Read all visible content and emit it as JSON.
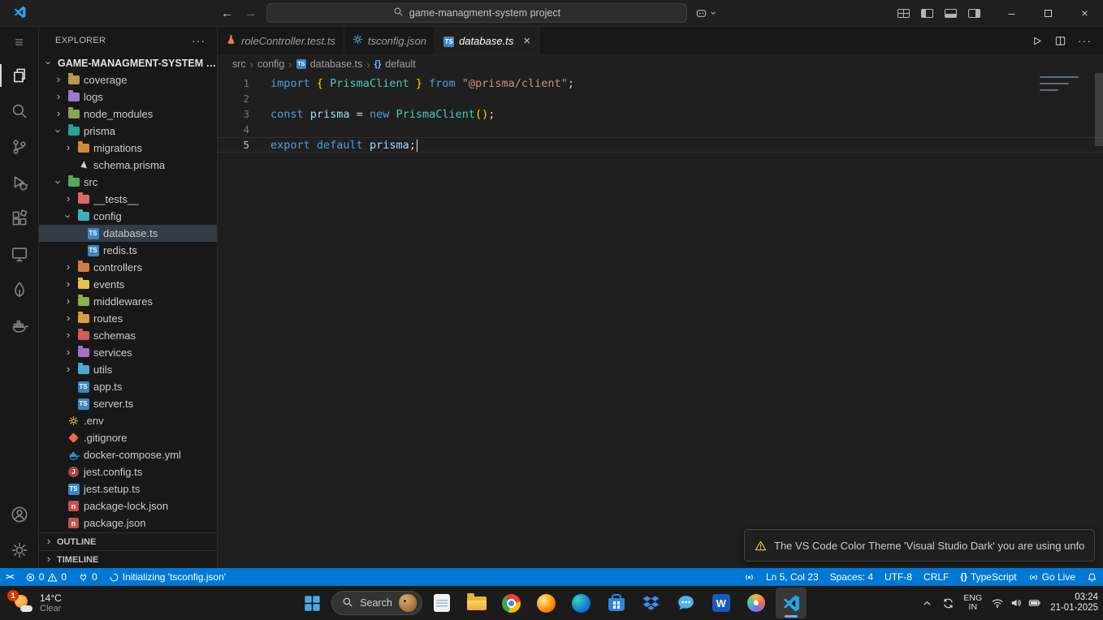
{
  "colors": {
    "titlebar": "#1f1f1f",
    "side": "#181818",
    "editor": "#1f1f1f",
    "statusbar": "#0078d4",
    "taskbar": "#1b1b1b",
    "selection": "#323d47",
    "ts_badge": "#3b86c4",
    "accent": "#6cb2f0"
  },
  "titlebar": {
    "search_text": "game-managment-system project",
    "layout_icons": [
      "layout-customize",
      "layout-sidebar-left",
      "layout-panel",
      "layout-sidebar-right"
    ],
    "window_controls": [
      "minimize",
      "maximize",
      "close"
    ]
  },
  "activity_bar": {
    "top": [
      {
        "name": "menu",
        "icon": "menu"
      },
      {
        "name": "explorer",
        "icon": "files",
        "active": true
      },
      {
        "name": "search",
        "icon": "search"
      },
      {
        "name": "source-control",
        "icon": "scm"
      },
      {
        "name": "run-and-debug",
        "icon": "debug"
      },
      {
        "name": "extensions",
        "icon": "ext"
      },
      {
        "name": "remote-explorer",
        "icon": "remote"
      },
      {
        "name": "mongodb",
        "icon": "mongo"
      },
      {
        "name": "docker",
        "icon": "docker"
      }
    ],
    "bottom": [
      {
        "name": "accounts",
        "icon": "account"
      },
      {
        "name": "manage",
        "icon": "gear"
      }
    ]
  },
  "sidebar": {
    "title": "EXPLORER",
    "tree": [
      {
        "label": "GAME-MANAGMENT-SYSTEM PROJECT",
        "depth": 0,
        "kind": "root",
        "chevron": "down"
      },
      {
        "label": "coverage",
        "depth": 1,
        "kind": "folder",
        "color": "#b79a4b",
        "chevron": "right"
      },
      {
        "label": "logs",
        "depth": 1,
        "kind": "folder",
        "color": "#9b7cc9",
        "chevron": "right"
      },
      {
        "label": "node_modules",
        "depth": 1,
        "kind": "folder",
        "color": "#87a556",
        "chevron": "right"
      },
      {
        "label": "prisma",
        "depth": 1,
        "kind": "folder",
        "color": "#2aa198",
        "chevron": "down"
      },
      {
        "label": "migrations",
        "depth": 2,
        "kind": "folder",
        "color": "#d08a3e",
        "chevron": "right"
      },
      {
        "label": "schema.prisma",
        "depth": 2,
        "kind": "prisma",
        "color": "#c8d3da"
      },
      {
        "label": "src",
        "depth": 1,
        "kind": "folder",
        "color": "#5aa85e",
        "chevron": "down"
      },
      {
        "label": "__tests__",
        "depth": 2,
        "kind": "folder",
        "color": "#d96a6a",
        "chevron": "right"
      },
      {
        "label": "config",
        "depth": 2,
        "kind": "folder",
        "color": "#3fb0c0",
        "chevron": "down"
      },
      {
        "label": "database.ts",
        "depth": 3,
        "kind": "ts",
        "selected": true
      },
      {
        "label": "redis.ts",
        "depth": 3,
        "kind": "ts"
      },
      {
        "label": "controllers",
        "depth": 2,
        "kind": "folder",
        "color": "#c97f4a",
        "chevron": "right"
      },
      {
        "label": "events",
        "depth": 2,
        "kind": "folder",
        "color": "#e2c24c",
        "chevron": "right"
      },
      {
        "label": "middlewares",
        "depth": 2,
        "kind": "folder",
        "color": "#8fae4e",
        "chevron": "right"
      },
      {
        "label": "routes",
        "depth": 2,
        "kind": "folder",
        "color": "#d8a03c",
        "chevron": "right"
      },
      {
        "label": "schemas",
        "depth": 2,
        "kind": "folder",
        "color": "#cf5d58",
        "chevron": "right"
      },
      {
        "label": "services",
        "depth": 2,
        "kind": "folder",
        "color": "#a86fc9",
        "chevron": "right"
      },
      {
        "label": "utils",
        "depth": 2,
        "kind": "folder",
        "color": "#4fa8cf",
        "chevron": "right"
      },
      {
        "label": "app.ts",
        "depth": 2,
        "kind": "ts"
      },
      {
        "label": "server.ts",
        "depth": 2,
        "kind": "ts"
      },
      {
        "label": ".env",
        "depth": 1,
        "kind": "gear",
        "color": "#d8bf45"
      },
      {
        "label": ".gitignore",
        "depth": 1,
        "kind": "git",
        "color": "#e8694d"
      },
      {
        "label": "docker-compose.yml",
        "depth": 1,
        "kind": "docker",
        "color": "#3a9fe0"
      },
      {
        "label": "jest.config.ts",
        "depth": 1,
        "kind": "jest",
        "color": "#a8453c"
      },
      {
        "label": "jest.setup.ts",
        "depth": 1,
        "kind": "ts"
      },
      {
        "label": "package-lock.json",
        "depth": 1,
        "kind": "npm",
        "color": "#c94f4f"
      },
      {
        "label": "package.json",
        "depth": 1,
        "kind": "npm",
        "color": "#c94f4f"
      }
    ],
    "sections": [
      "OUTLINE",
      "TIMELINE"
    ]
  },
  "tabs": [
    {
      "label": "roleController.test.ts",
      "icon": "flask"
    },
    {
      "label": "tsconfig.json",
      "icon": "gear"
    },
    {
      "label": "database.ts",
      "icon": "ts",
      "active": true
    }
  ],
  "editor_actions": [
    "run",
    "split",
    "more"
  ],
  "breadcrumb": {
    "items": [
      {
        "label": "src"
      },
      {
        "label": "config"
      },
      {
        "label": "database.ts",
        "icon": "ts"
      },
      {
        "label": "default",
        "icon": "symbol"
      }
    ]
  },
  "editor": {
    "token_colors": {
      "kw": "#569cd6",
      "ty": "#4ec9b0",
      "vr": "#9cdcfe",
      "st": "#ce9178",
      "pl": "#d4d4d4",
      "br": "#ffd700"
    },
    "lines": [
      {
        "n": 1,
        "tokens": [
          {
            "t": "import ",
            "c": "kw"
          },
          {
            "t": "{ ",
            "c": "br"
          },
          {
            "t": "PrismaClient",
            "c": "ty"
          },
          {
            "t": " }",
            "c": "br"
          },
          {
            "t": " ",
            "c": "pl"
          },
          {
            "t": "from ",
            "c": "kw"
          },
          {
            "t": "\"@prisma/client\"",
            "c": "st"
          },
          {
            "t": ";",
            "c": "pl"
          }
        ]
      },
      {
        "n": 2,
        "tokens": []
      },
      {
        "n": 3,
        "tokens": [
          {
            "t": "const ",
            "c": "kw"
          },
          {
            "t": "prisma ",
            "c": "vr"
          },
          {
            "t": "= ",
            "c": "pl"
          },
          {
            "t": "new ",
            "c": "kw"
          },
          {
            "t": "PrismaClient",
            "c": "ty"
          },
          {
            "t": "()",
            "c": "br"
          },
          {
            "t": ";",
            "c": "pl"
          }
        ]
      },
      {
        "n": 4,
        "tokens": []
      },
      {
        "n": 5,
        "active": true,
        "cursor": true,
        "tokens": [
          {
            "t": "export ",
            "c": "kw"
          },
          {
            "t": "default ",
            "c": "kw"
          },
          {
            "t": "prisma",
            "c": "vr"
          },
          {
            "t": ";",
            "c": "pl"
          }
        ]
      }
    ]
  },
  "notification": {
    "text": "The VS Code Color Theme 'Visual Studio Dark' you are using unfortun..."
  },
  "status_bar": {
    "left": [
      {
        "name": "remote-indicator",
        "parts": [
          {
            "icon": "remote"
          }
        ]
      },
      {
        "name": "problems",
        "parts": [
          {
            "icon": "error",
            "label": "0"
          },
          {
            "icon": "warn",
            "label": "0"
          }
        ]
      },
      {
        "name": "ports",
        "parts": [
          {
            "icon": "plug",
            "label": "0"
          }
        ]
      },
      {
        "name": "sync-status",
        "parts": [
          {
            "icon": "spinner",
            "label": "Initializing 'tsconfig.json'"
          }
        ]
      }
    ],
    "right": [
      {
        "name": "tunnel",
        "parts": [
          {
            "icon": "antenna"
          }
        ]
      },
      {
        "name": "cursor-position",
        "parts": [
          {
            "label": "Ln 5, Col 23"
          }
        ]
      },
      {
        "name": "indentation",
        "parts": [
          {
            "label": "Spaces: 4"
          }
        ]
      },
      {
        "name": "encoding",
        "parts": [
          {
            "label": "UTF-8"
          }
        ]
      },
      {
        "name": "eol",
        "parts": [
          {
            "label": "CRLF"
          }
        ]
      },
      {
        "name": "language-mode",
        "parts": [
          {
            "icon": "braces",
            "label": "TypeScript"
          }
        ]
      },
      {
        "name": "go-live",
        "parts": [
          {
            "icon": "antenna",
            "label": "Go Live"
          }
        ]
      },
      {
        "name": "notifications",
        "parts": [
          {
            "icon": "bell"
          }
        ]
      }
    ]
  },
  "taskbar": {
    "weather": {
      "temperature": "14°C",
      "condition": "Clear",
      "badge": "1"
    },
    "search_label": "Search",
    "apps": [
      {
        "name": "start"
      },
      {
        "name": "search"
      },
      {
        "name": "notepad"
      },
      {
        "name": "file-explorer"
      },
      {
        "name": "chrome"
      },
      {
        "name": "firefox"
      },
      {
        "name": "edge"
      },
      {
        "name": "store"
      },
      {
        "name": "dropbox"
      },
      {
        "name": "chat"
      },
      {
        "name": "word"
      },
      {
        "name": "photos"
      },
      {
        "name": "vscode",
        "active": true
      }
    ],
    "tray": {
      "language_top": "ENG",
      "language_bottom": "IN",
      "time": "03:24",
      "date": "21-01-2025",
      "icons": [
        "chevron-up",
        "sync",
        "wifi",
        "volume",
        "battery"
      ]
    }
  }
}
